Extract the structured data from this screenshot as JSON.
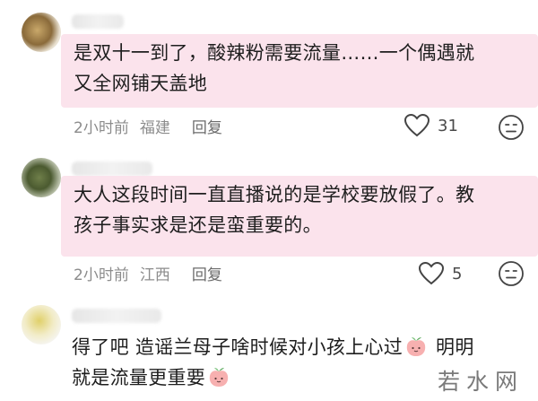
{
  "comments": [
    {
      "lines": [
        "是双十一到了，酸辣粉需要流量……一个偶遇就",
        "又全网铺天盖地"
      ],
      "time": "2小时前",
      "location": "福建",
      "reply_label": "回复",
      "likes": "31"
    },
    {
      "lines": [
        "大人这段时间一直直播说的是学校要放假了。教",
        "孩子事实求是还是蛮重要的。"
      ],
      "time": "2小时前",
      "location": "江西",
      "reply_label": "回复",
      "likes": "5"
    },
    {
      "line1_a": "得了吧 造谣兰母子啥时候对小孩上心过",
      "line1_b": " 明明",
      "line2": "就是流量更重要"
    }
  ],
  "watermark": "若水网",
  "icons": {
    "like": "heart-outline-icon",
    "dislike": "meh-face-icon",
    "emoji": "peach-emoji-icon"
  },
  "colors": {
    "bubble_highlight": "#fbe3ec",
    "meta_text": "#8c8c8c",
    "peach": "#f4a3a3"
  }
}
